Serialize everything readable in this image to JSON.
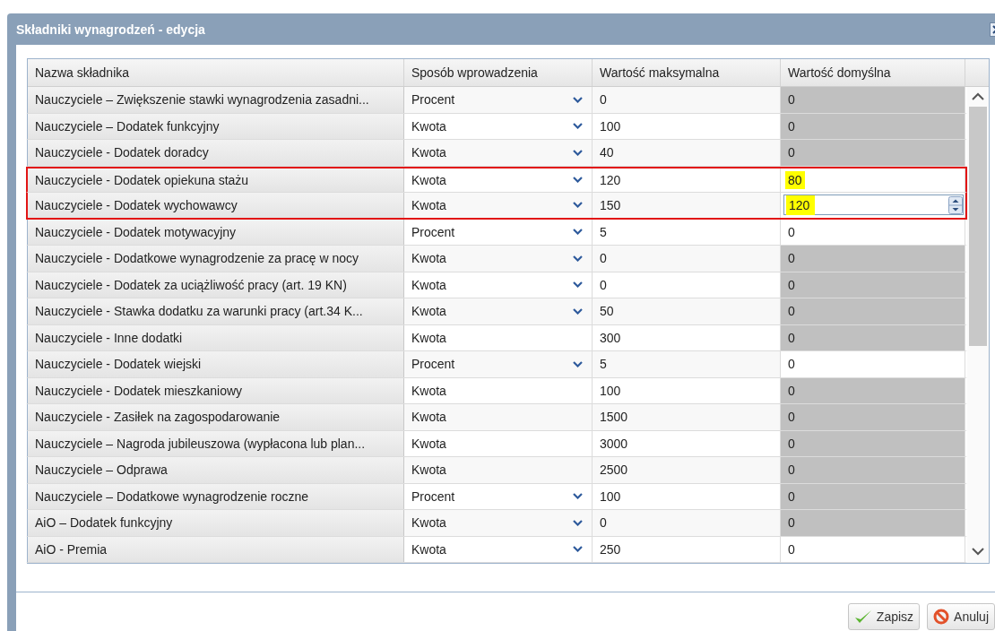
{
  "window": {
    "title": "Składniki wynagrodzeń - edycja"
  },
  "table": {
    "columns": [
      "Nazwa składnika",
      "Sposób wprowadzenia",
      "Wartość maksymalna",
      "Wartość domyślna"
    ],
    "rows": [
      {
        "name": "Nauczyciele – Zwiększenie stawki wynagrodzenia zasadni...",
        "method": "Procent",
        "dropdown": true,
        "max": "0",
        "default": "0",
        "disabled": true,
        "highlighted": false,
        "editing": false,
        "marked": false
      },
      {
        "name": "Nauczyciele – Dodatek funkcyjny",
        "method": "Kwota",
        "dropdown": true,
        "max": "100",
        "default": "0",
        "disabled": true,
        "highlighted": false,
        "editing": false,
        "marked": false
      },
      {
        "name": "Nauczyciele - Dodatek doradcy",
        "method": "Kwota",
        "dropdown": true,
        "max": "40",
        "default": "0",
        "disabled": true,
        "highlighted": false,
        "editing": false,
        "marked": false
      },
      {
        "name": "Nauczyciele - Dodatek opiekuna stażu",
        "method": "Kwota",
        "dropdown": true,
        "max": "120",
        "default": "80",
        "disabled": false,
        "highlighted": true,
        "editing": false,
        "marked": true
      },
      {
        "name": "Nauczyciele - Dodatek wychowawcy",
        "method": "Kwota",
        "dropdown": true,
        "max": "150",
        "default": "120",
        "disabled": false,
        "highlighted": true,
        "editing": true,
        "marked": true
      },
      {
        "name": "Nauczyciele - Dodatek motywacyjny",
        "method": "Procent",
        "dropdown": true,
        "max": "5",
        "default": "0",
        "disabled": false,
        "highlighted": false,
        "editing": false,
        "marked": false
      },
      {
        "name": "Nauczyciele - Dodatkowe wynagrodzenie za pracę w nocy",
        "method": "Kwota",
        "dropdown": true,
        "max": "0",
        "default": "0",
        "disabled": true,
        "highlighted": false,
        "editing": false,
        "marked": false
      },
      {
        "name": "Nauczyciele - Dodatek za uciążliwość pracy (art. 19 KN)",
        "method": "Kwota",
        "dropdown": true,
        "max": "0",
        "default": "0",
        "disabled": true,
        "highlighted": false,
        "editing": false,
        "marked": false
      },
      {
        "name": "Nauczyciele - Stawka dodatku za warunki pracy (art.34 K...",
        "method": "Kwota",
        "dropdown": true,
        "max": "50",
        "default": "0",
        "disabled": true,
        "highlighted": false,
        "editing": false,
        "marked": false
      },
      {
        "name": "Nauczyciele - Inne dodatki",
        "method": "Kwota",
        "dropdown": false,
        "max": "300",
        "default": "0",
        "disabled": true,
        "highlighted": false,
        "editing": false,
        "marked": false
      },
      {
        "name": "Nauczyciele - Dodatek wiejski",
        "method": "Procent",
        "dropdown": true,
        "max": "5",
        "default": "0",
        "disabled": false,
        "highlighted": false,
        "editing": false,
        "marked": false
      },
      {
        "name": "Nauczyciele - Dodatek mieszkaniowy",
        "method": "Kwota",
        "dropdown": false,
        "max": "100",
        "default": "0",
        "disabled": true,
        "highlighted": false,
        "editing": false,
        "marked": false
      },
      {
        "name": "Nauczyciele - Zasiłek na zagospodarowanie",
        "method": "Kwota",
        "dropdown": false,
        "max": "1500",
        "default": "0",
        "disabled": true,
        "highlighted": false,
        "editing": false,
        "marked": false
      },
      {
        "name": "Nauczyciele – Nagroda jubileuszowa (wypłacona lub plan...",
        "method": "Kwota",
        "dropdown": false,
        "max": "3000",
        "default": "0",
        "disabled": true,
        "highlighted": false,
        "editing": false,
        "marked": false
      },
      {
        "name": "Nauczyciele – Odprawa",
        "method": "Kwota",
        "dropdown": false,
        "max": "2500",
        "default": "0",
        "disabled": true,
        "highlighted": false,
        "editing": false,
        "marked": false
      },
      {
        "name": "Nauczyciele – Dodatkowe wynagrodzenie roczne",
        "method": "Procent",
        "dropdown": true,
        "max": "100",
        "default": "0",
        "disabled": true,
        "highlighted": false,
        "editing": false,
        "marked": false
      },
      {
        "name": "AiO – Dodatek funkcyjny",
        "method": "Kwota",
        "dropdown": true,
        "max": "0",
        "default": "0",
        "disabled": true,
        "highlighted": false,
        "editing": false,
        "marked": false
      },
      {
        "name": "AiO - Premia",
        "method": "Kwota",
        "dropdown": true,
        "max": "250",
        "default": "0",
        "disabled": false,
        "highlighted": false,
        "editing": false,
        "marked": false
      }
    ]
  },
  "buttons": [
    {
      "label": "Zapisz",
      "kind": "save"
    },
    {
      "label": "Anuluj",
      "kind": "cancel"
    }
  ]
}
